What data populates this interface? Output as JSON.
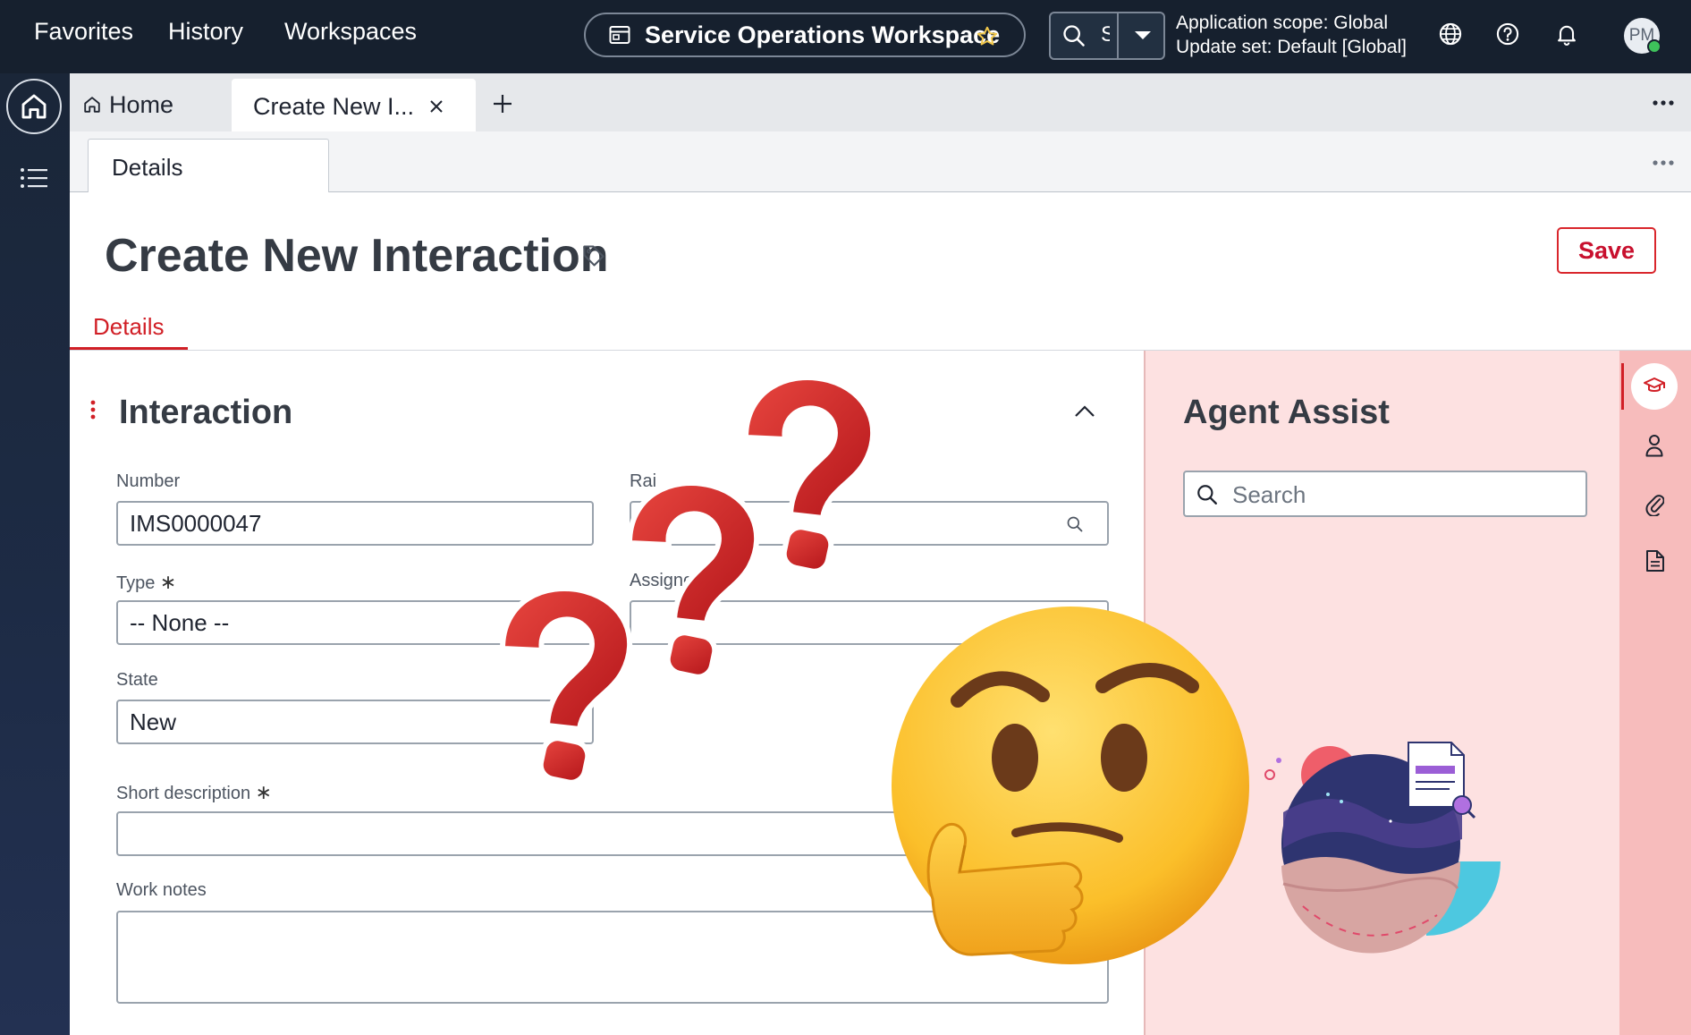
{
  "topnav": {
    "links": [
      "Favorites",
      "History",
      "Workspaces"
    ],
    "workspace_title": "Service Operations Workspace",
    "search_value": "S",
    "scope_line1": "Application scope: Global",
    "scope_line2": "Update set: Default [Global]",
    "avatar_initials": "PM",
    "icons": [
      "workspace-icon",
      "star-icon",
      "search-icon",
      "chevron-down-icon",
      "globe-icon",
      "help-icon",
      "bell-icon"
    ]
  },
  "rail": {
    "icons": [
      "home-icon",
      "list-icon"
    ]
  },
  "tabs": {
    "home_label": "Home",
    "active_label": "Create New I...",
    "icons": [
      "close-icon",
      "plus-icon",
      "more-icon"
    ]
  },
  "subtabs": {
    "details_label": "Details"
  },
  "page": {
    "title": "Create New Interaction",
    "save_label": "Save",
    "details_tab": "Details"
  },
  "form": {
    "section_title": "Interaction",
    "number_label": "Number",
    "number_value": "IMS0000047",
    "raised_label": "Rai",
    "type_label": "Type",
    "type_value": "-- None --",
    "assigned_label": "Assigned",
    "state_label": "State",
    "state_value": "New",
    "short_desc_label": "Short description",
    "work_notes_label": "Work notes",
    "required_mark": "∗"
  },
  "assist": {
    "title": "Agent Assist",
    "search_placeholder": "Search",
    "rail_icons": [
      "learning-cap-icon",
      "person-icon",
      "paperclip-icon",
      "document-icon"
    ]
  },
  "colors": {
    "nav_bg": "#16202e",
    "accent_red": "#d11f26",
    "assist_bg": "#fde1e1",
    "assist_rail_bg": "#f7bcbc"
  }
}
